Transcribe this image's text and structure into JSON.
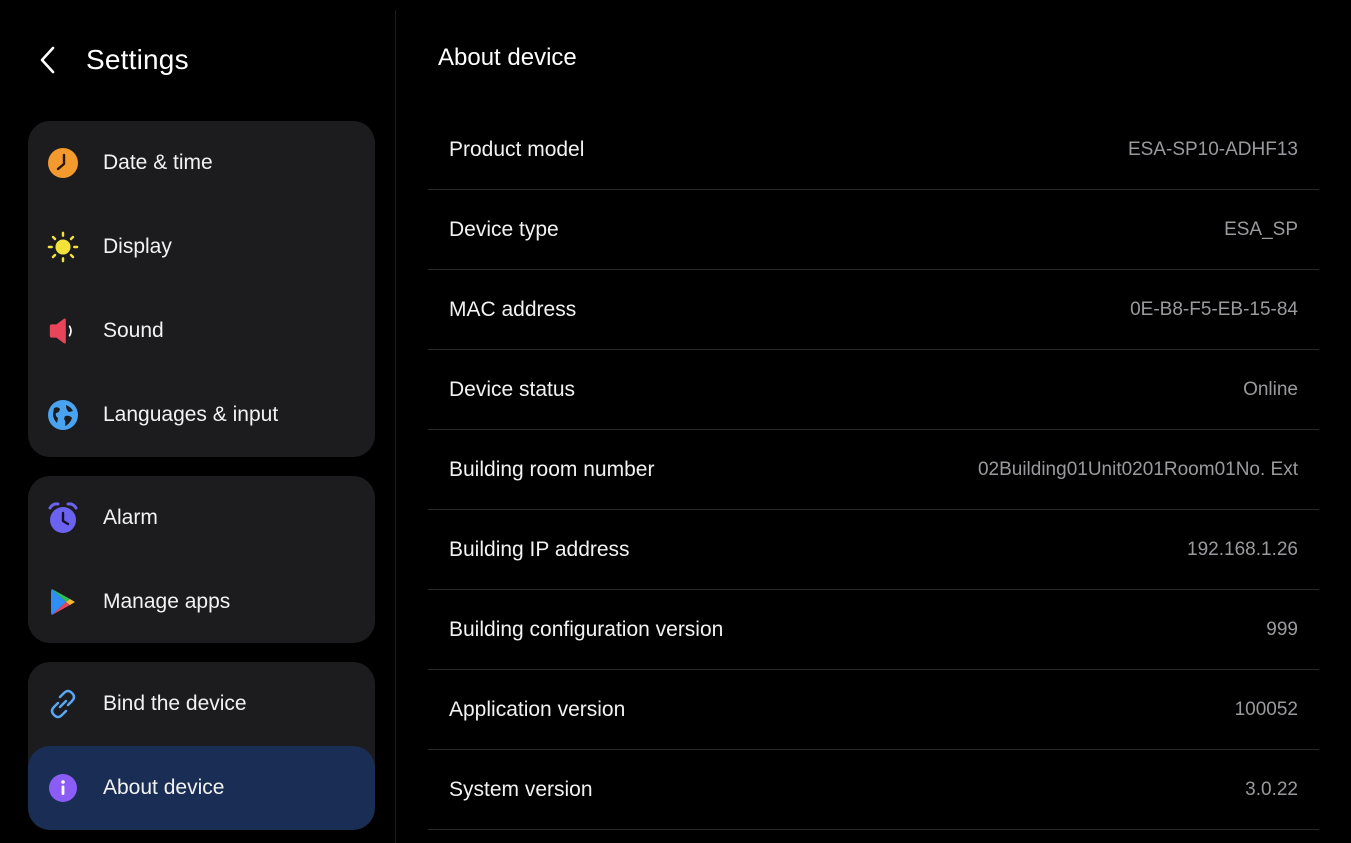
{
  "colors": {
    "background": "#000000",
    "group_bg": "#1c1c1e",
    "active_item_bg": "#1a2d54",
    "divider": "#2a2a2c",
    "value_text": "#9a9a9e",
    "clock_icon": "#f39a2e",
    "sun_icon": "#f2e23a",
    "sound_icon": "#e8445a",
    "globe_icon": "#4aa3f0",
    "alarm_icon": "#6b63f0",
    "link_icon": "#5aa8f5",
    "info_icon": "#8b5cf6"
  },
  "sidebar": {
    "title": "Settings",
    "back_icon": "chevron-left-icon",
    "groups": [
      {
        "items": [
          {
            "label": "Date & time",
            "icon": "clock-icon"
          },
          {
            "label": "Display",
            "icon": "sun-icon"
          },
          {
            "label": "Sound",
            "icon": "speaker-icon"
          },
          {
            "label": "Languages & input",
            "icon": "globe-icon"
          }
        ]
      },
      {
        "items": [
          {
            "label": "Alarm",
            "icon": "alarm-clock-icon"
          },
          {
            "label": "Manage apps",
            "icon": "play-store-icon"
          }
        ]
      },
      {
        "items": [
          {
            "label": "Bind the device",
            "icon": "link-icon"
          },
          {
            "label": "About device",
            "icon": "info-icon",
            "selected": true
          }
        ]
      }
    ]
  },
  "main": {
    "title": "About device",
    "rows": [
      {
        "label": "Product model",
        "value": "ESA-SP10-ADHF13"
      },
      {
        "label": "Device type",
        "value": "ESA_SP"
      },
      {
        "label": "MAC address",
        "value": "0E-B8-F5-EB-15-84"
      },
      {
        "label": "Device status",
        "value": "Online"
      },
      {
        "label": "Building room number",
        "value": "02Building01Unit0201Room01No. Ext"
      },
      {
        "label": "Building IP address",
        "value": "192.168.1.26"
      },
      {
        "label": "Building configuration version",
        "value": "999"
      },
      {
        "label": "Application version",
        "value": "100052"
      },
      {
        "label": "System version",
        "value": "3.0.22"
      }
    ]
  }
}
